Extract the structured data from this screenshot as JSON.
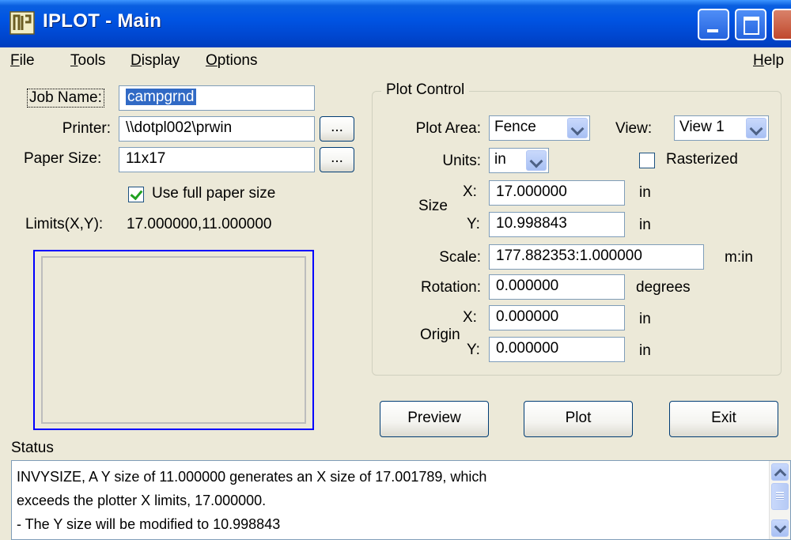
{
  "window": {
    "title": "IPLOT - Main"
  },
  "menu": {
    "file": "File",
    "tools": "Tools",
    "display": "Display",
    "options": "Options",
    "help": "Help"
  },
  "left": {
    "job_name_label": "Job Name:",
    "job_name_value": "campgrnd",
    "printer_label": "Printer:",
    "printer_value": "\\\\dotpl002\\prwin",
    "paper_size_label": "Paper Size:",
    "paper_size_value": "11x17",
    "browse_label": "...",
    "use_full_paper_label": "Use full paper size",
    "use_full_paper_checked": true,
    "limits_label": "Limits(X,Y):",
    "limits_value": "17.000000,11.000000"
  },
  "plot_control": {
    "title": "Plot Control",
    "plot_area_label": "Plot Area:",
    "plot_area_value": "Fence",
    "view_label": "View:",
    "view_value": "View 1",
    "units_label": "Units:",
    "units_value": "in",
    "rasterized_label": "Rasterized",
    "rasterized_checked": false,
    "size_label": "Size",
    "x_label": "X:",
    "y_label": "Y:",
    "size_x": "17.000000",
    "size_y": "10.998843",
    "unit_in": "in",
    "scale_label": "Scale:",
    "scale_value": "177.882353:1.000000",
    "scale_unit": "m:in",
    "rotation_label": "Rotation:",
    "rotation_value": "0.000000",
    "rotation_unit": "degrees",
    "origin_label": "Origin",
    "origin_x": "0.000000",
    "origin_y": "0.000000"
  },
  "buttons": {
    "preview": "Preview",
    "plot": "Plot",
    "exit": "Exit"
  },
  "status": {
    "label": "Status",
    "lines": [
      "INVYSIZE, A Y size of 11.000000 generates an X size of 17.001789, which",
      " exceeds the plotter X limits, 17.000000.",
      "- The Y size will be modified to 10.998843"
    ]
  },
  "colors": {
    "titlebar": "#0054e3",
    "window_bg": "#ece9d8",
    "preview_border": "#0000ff",
    "selection": "#316ac5"
  }
}
